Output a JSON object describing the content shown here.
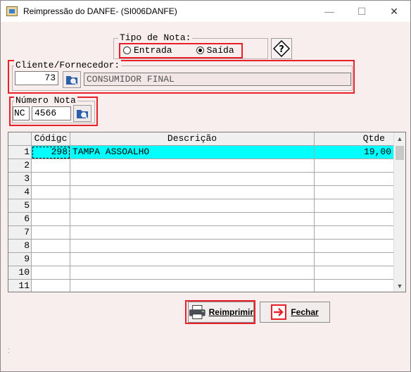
{
  "window": {
    "title": "Reimpressão do DANFE- (SI006DANFE)",
    "minimize": "—",
    "maximize": "☐",
    "close": "✕"
  },
  "tipo_nota": {
    "legend": "Tipo de Nota:",
    "options": [
      {
        "label": "Entrada",
        "selected": false
      },
      {
        "label": "Saída",
        "selected": true
      }
    ]
  },
  "help": {
    "glyph": "?"
  },
  "cliente": {
    "legend": "Cliente/Fornecedor:",
    "code": "73",
    "name": "CONSUMIDOR FINAL"
  },
  "numero_nota": {
    "legend": "Número Nota",
    "serie": "NC",
    "numero": "4566"
  },
  "grid": {
    "columns": [
      "Códigc",
      "Descrição",
      "Qtde"
    ],
    "row_numbers": [
      "1",
      "2",
      "3",
      "4",
      "5",
      "6",
      "7",
      "8",
      "9",
      "10",
      "11"
    ],
    "rows": [
      {
        "codigo": "298",
        "descricao": "TAMPA ASSOALHO",
        "qtde": "19,00"
      }
    ]
  },
  "buttons": {
    "reimprimir": "Reimprimir",
    "fechar": "Fechar"
  },
  "colors": {
    "highlight": "#00ffff",
    "annotation": "#e8202a"
  }
}
